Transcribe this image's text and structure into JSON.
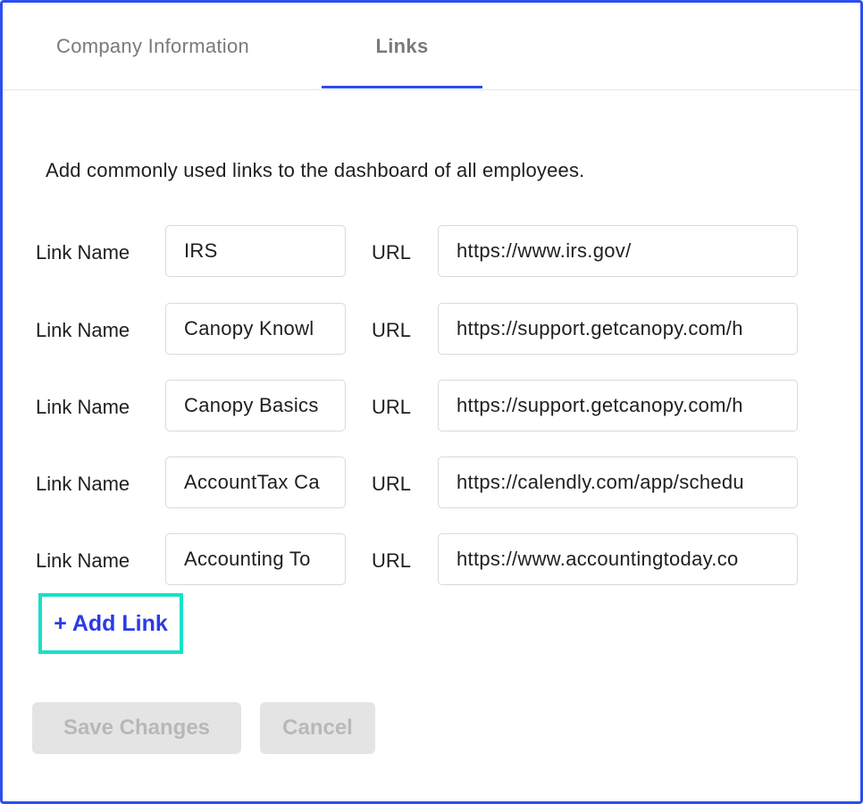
{
  "tabs": {
    "company": "Company Information",
    "links": "Links"
  },
  "intro": "Add commonly used links to the dashboard of all employees.",
  "row_labels": {
    "name": "Link Name",
    "url": "URL"
  },
  "links": [
    {
      "name": "IRS",
      "url": "https://www.irs.gov/"
    },
    {
      "name": "Canopy Knowl",
      "url": "https://support.getcanopy.com/h"
    },
    {
      "name": "Canopy Basics",
      "url": "https://support.getcanopy.com/h"
    },
    {
      "name": "AccountTax Ca",
      "url": "https://calendly.com/app/schedu"
    },
    {
      "name": "Accounting To",
      "url": "https://www.accountingtoday.co"
    }
  ],
  "add_link_label": "+ Add Link",
  "buttons": {
    "save": "Save Changes",
    "cancel": "Cancel"
  },
  "colors": {
    "accent": "#2b4ff0",
    "add_link_text": "#2b3be8",
    "highlight": "#19e0c8",
    "disabled_bg": "#e4e4e4",
    "disabled_text": "#b8b8b8"
  }
}
